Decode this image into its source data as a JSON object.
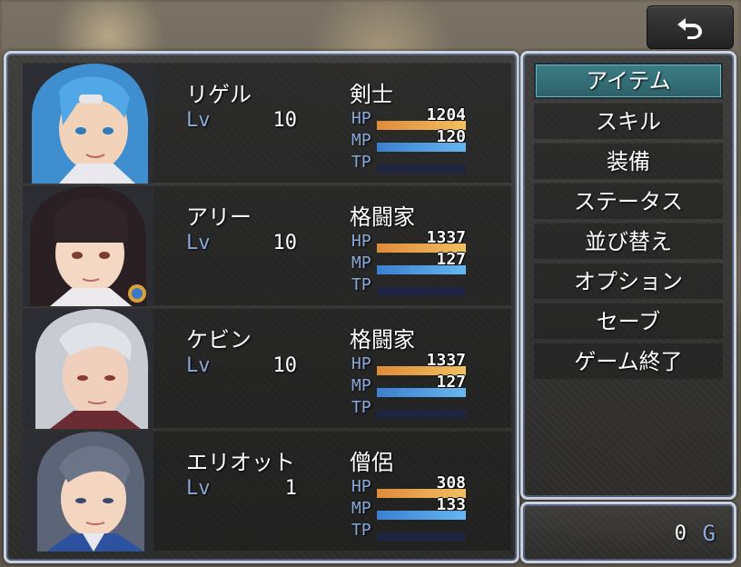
{
  "status": {
    "actors": [
      {
        "name": "リゲル",
        "class": "剣士",
        "lv_label": "Lv",
        "lv": "10",
        "hp_label": "HP",
        "hp": "1204",
        "hp_rate": 1.0,
        "mp_label": "MP",
        "mp": "120",
        "mp_rate": 1.0,
        "tp_label": "TP",
        "tp_rate": 0.0,
        "portrait_icon": "actor-portrait-blue-hair"
      },
      {
        "name": "アリー",
        "class": "格闘家",
        "lv_label": "Lv",
        "lv": "10",
        "hp_label": "HP",
        "hp": "1337",
        "hp_rate": 1.0,
        "mp_label": "MP",
        "mp": "127",
        "mp_rate": 1.0,
        "tp_label": "TP",
        "tp_rate": 0.0,
        "portrait_icon": "actor-portrait-black-hair"
      },
      {
        "name": "ケビン",
        "class": "格闘家",
        "lv_label": "Lv",
        "lv": "10",
        "hp_label": "HP",
        "hp": "1337",
        "hp_rate": 1.0,
        "mp_label": "MP",
        "mp": "127",
        "mp_rate": 1.0,
        "tp_label": "TP",
        "tp_rate": 0.0,
        "portrait_icon": "actor-portrait-silver-hair"
      },
      {
        "name": "エリオット",
        "class": "僧侶",
        "lv_label": "Lv",
        "lv": "1",
        "hp_label": "HP",
        "hp": "308",
        "hp_rate": 1.0,
        "mp_label": "MP",
        "mp": "133",
        "mp_rate": 1.0,
        "tp_label": "TP",
        "tp_rate": 0.0,
        "portrait_icon": "actor-portrait-grey-hair"
      }
    ]
  },
  "menu": {
    "items": [
      {
        "label": "アイテム",
        "selected": true
      },
      {
        "label": "スキル",
        "selected": false
      },
      {
        "label": "装備",
        "selected": false
      },
      {
        "label": "ステータス",
        "selected": false
      },
      {
        "label": "並び替え",
        "selected": false
      },
      {
        "label": "オプション",
        "selected": false
      },
      {
        "label": "セーブ",
        "selected": false
      },
      {
        "label": "ゲーム終了",
        "selected": false
      }
    ]
  },
  "gold": {
    "value": "0",
    "unit": "G"
  },
  "back_button": {
    "icon": "back-arrow-icon"
  },
  "colors": {
    "system_label": "#8aa9d8",
    "hp_gauge": "#e08a3a",
    "mp_gauge": "#3a7fd0",
    "selection": "#3c7e86",
    "window_border": "#c9d3e3"
  }
}
